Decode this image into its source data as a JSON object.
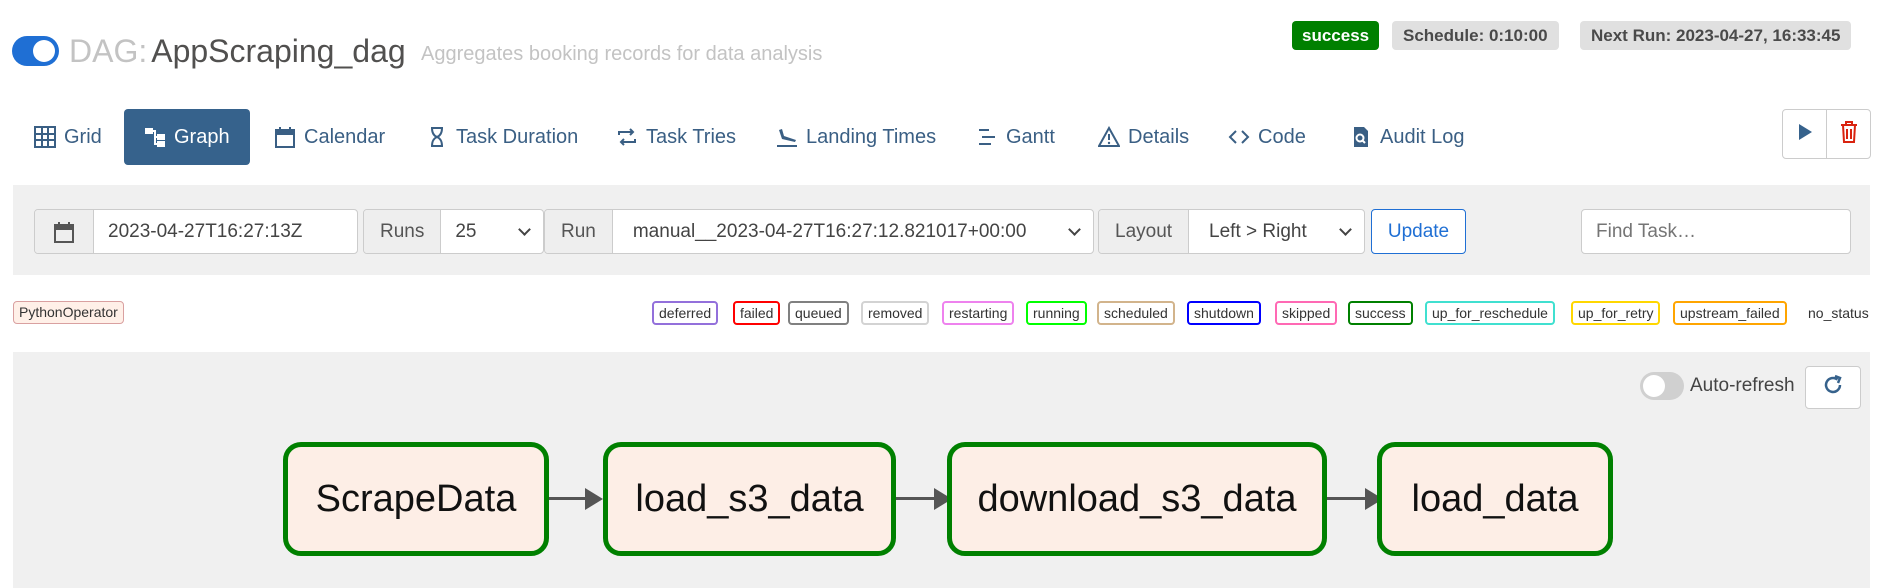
{
  "header": {
    "dag_prefix": "DAG:",
    "dag_name": "AppScraping_dag",
    "description": "Aggregates booking records for data analysis",
    "status": "success",
    "schedule": "Schedule: 0:10:00",
    "next_run": "Next Run: 2023-04-27, 16:33:45"
  },
  "nav": {
    "tabs": [
      {
        "label": "Grid",
        "icon": "grid-icon"
      },
      {
        "label": "Graph",
        "icon": "graph-icon",
        "active": true
      },
      {
        "label": "Calendar",
        "icon": "calendar-icon"
      },
      {
        "label": "Task Duration",
        "icon": "hourglass-icon"
      },
      {
        "label": "Task Tries",
        "icon": "retry-icon"
      },
      {
        "label": "Landing Times",
        "icon": "plane-landing-icon"
      },
      {
        "label": "Gantt",
        "icon": "gantt-icon"
      },
      {
        "label": "Details",
        "icon": "warning-triangle-icon"
      },
      {
        "label": "Code",
        "icon": "code-icon"
      },
      {
        "label": "Audit Log",
        "icon": "audit-log-icon"
      }
    ]
  },
  "filters": {
    "date_value": "2023-04-27T16:27:13Z",
    "runs_label": "Runs",
    "runs_value": "25",
    "run_label": "Run",
    "run_value": "manual__2023-04-27T16:27:12.821017+00:00",
    "layout_label": "Layout",
    "layout_value": "Left > Right",
    "update_label": "Update",
    "find_task_placeholder": "Find Task…"
  },
  "legend": {
    "operator": "PythonOperator",
    "states": [
      {
        "label": "deferred",
        "color": "#9370db"
      },
      {
        "label": "failed",
        "color": "#ff0000"
      },
      {
        "label": "queued",
        "color": "#808080"
      },
      {
        "label": "removed",
        "color": "#d3d3d3"
      },
      {
        "label": "restarting",
        "color": "#ee82ee"
      },
      {
        "label": "running",
        "color": "#00ff00"
      },
      {
        "label": "scheduled",
        "color": "#d2b48c"
      },
      {
        "label": "shutdown",
        "color": "#0000ff"
      },
      {
        "label": "skipped",
        "color": "#ff69b4"
      },
      {
        "label": "success",
        "color": "#008000"
      },
      {
        "label": "up_for_reschedule",
        "color": "#40e0d0"
      },
      {
        "label": "up_for_retry",
        "color": "#ffd700"
      },
      {
        "label": "upstream_failed",
        "color": "#ffa500"
      },
      {
        "label": "no_status",
        "color": "transparent"
      }
    ]
  },
  "graph": {
    "auto_refresh_label": "Auto-refresh",
    "nodes": [
      "ScrapeData",
      "load_s3_data",
      "download_s3_data",
      "load_data"
    ],
    "node_state": "success"
  },
  "colors": {
    "accent": "#1f6fd4",
    "nav_active": "#36628c",
    "success": "#008000",
    "node_fill": "#fdeee6"
  }
}
